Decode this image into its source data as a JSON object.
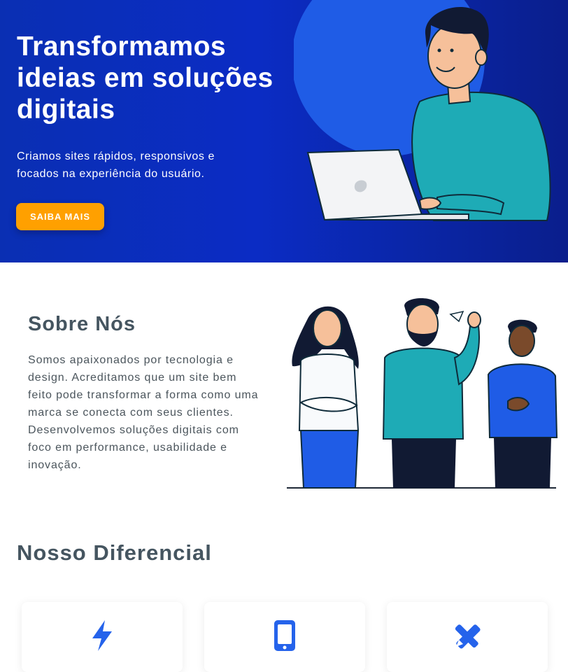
{
  "hero": {
    "title": "Transformamos ideias em soluções digitais",
    "subtitle": "Criamos sites rápidos, responsivos e focados na experiência do usuário.",
    "cta_label": "SAIBA MAIS",
    "illustration": "person-with-laptop-illustration"
  },
  "about": {
    "title": "Sobre Nós",
    "text": "Somos apaixonados por tecnologia e design. Acreditamos que um site bem feito pode transformar a forma como uma marca se conecta com seus clientes. Desenvolvemos soluções digitais com foco em performance, usabilidade e inovação.",
    "illustration": "team-of-three-illustration"
  },
  "differentials": {
    "title": "Nosso Diferencial",
    "cards": [
      {
        "icon": "lightning-icon"
      },
      {
        "icon": "mobile-icon"
      },
      {
        "icon": "design-tools-icon"
      }
    ]
  },
  "colors": {
    "hero_bg": "#0b2cc4",
    "cta": "#ffa000",
    "heading": "#455560",
    "icon_accent": "#2563eb"
  }
}
